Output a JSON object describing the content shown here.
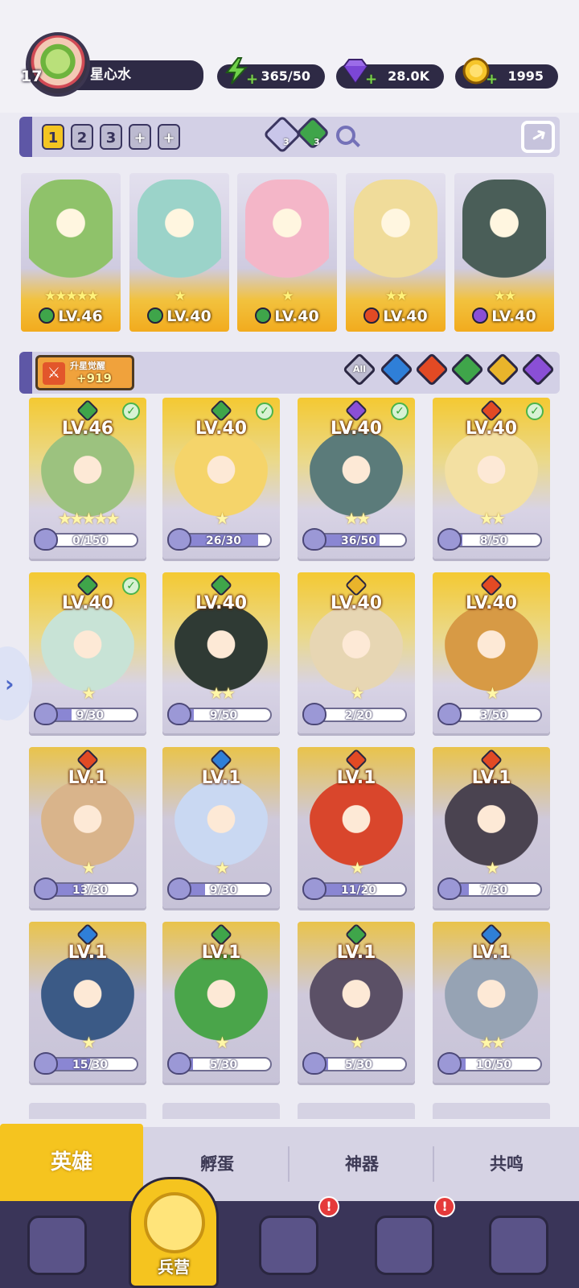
{
  "player": {
    "level": "17",
    "name": "星心水"
  },
  "resources": {
    "energy": "365/50",
    "gems": "28.0K",
    "coins": "1995"
  },
  "team_bar": {
    "tabs": [
      "1",
      "2",
      "3",
      "+",
      "+"
    ],
    "active_tab": "1",
    "gem_purple_count": "3",
    "gem_green_count": "3"
  },
  "team": [
    {
      "level": "LV.46",
      "stars": "★★★★★",
      "element": "nature",
      "art_color": "#8fc26a"
    },
    {
      "level": "LV.40",
      "stars": "★",
      "element": "nature",
      "art_color": "#9bd3c9"
    },
    {
      "level": "LV.40",
      "stars": "★",
      "element": "nature",
      "art_color": "#f4b6c8"
    },
    {
      "level": "LV.40",
      "stars": "★★",
      "element": "fire",
      "art_color": "#f0dc9a"
    },
    {
      "level": "LV.40",
      "stars": "★★",
      "element": "dark",
      "art_color": "#4a5e58"
    }
  ],
  "awaken": {
    "label": "升星觉醒",
    "value": "+919"
  },
  "filters": {
    "all_label": "All",
    "elements": [
      "water",
      "fire",
      "nature",
      "light",
      "dark"
    ]
  },
  "heroes": [
    {
      "level": "LV.46",
      "element": "nature",
      "checked": true,
      "stars": "★★★★★",
      "progress": "0/150",
      "fill": 0.0,
      "art": "#9cc27f"
    },
    {
      "level": "LV.40",
      "element": "nature",
      "checked": true,
      "stars": "★",
      "progress": "26/30",
      "fill": 0.87,
      "art": "#f5d46a"
    },
    {
      "level": "LV.40",
      "element": "dark",
      "checked": true,
      "stars": "★★",
      "progress": "36/50",
      "fill": 0.72,
      "art": "#5b7b7a"
    },
    {
      "level": "LV.40",
      "element": "fire",
      "checked": true,
      "stars": "★★",
      "progress": "8/50",
      "fill": 0.16,
      "art": "#f3e0a2"
    },
    {
      "level": "LV.40",
      "element": "nature",
      "checked": true,
      "stars": "★",
      "progress": "9/30",
      "fill": 0.3,
      "art": "#c8e3d6"
    },
    {
      "level": "LV.40",
      "element": "nature",
      "checked": false,
      "stars": "★★",
      "progress": "9/50",
      "fill": 0.18,
      "art": "#2f3a34"
    },
    {
      "level": "LV.40",
      "element": "light",
      "checked": false,
      "stars": "★",
      "progress": "2/20",
      "fill": 0.1,
      "art": "#e7d6b3"
    },
    {
      "level": "LV.40",
      "element": "fire",
      "checked": false,
      "stars": "★",
      "progress": "3/50",
      "fill": 0.06,
      "art": "#d79a45"
    },
    {
      "level": "LV.1",
      "element": "fire",
      "checked": false,
      "stars": "★",
      "progress": "13/30",
      "fill": 0.43,
      "art": "#d9b48b"
    },
    {
      "level": "LV.1",
      "element": "water",
      "checked": false,
      "stars": "★",
      "progress": "9/30",
      "fill": 0.3,
      "art": "#c9d8f2"
    },
    {
      "level": "LV.1",
      "element": "fire",
      "checked": false,
      "stars": "★",
      "progress": "11/20",
      "fill": 0.55,
      "art": "#d9462c"
    },
    {
      "level": "LV.1",
      "element": "fire",
      "checked": false,
      "stars": "★",
      "progress": "7/30",
      "fill": 0.23,
      "art": "#4a4350"
    },
    {
      "level": "LV.1",
      "element": "water",
      "checked": false,
      "stars": "★",
      "progress": "15/30",
      "fill": 0.5,
      "art": "#3b5a86"
    },
    {
      "level": "LV.1",
      "element": "nature",
      "checked": false,
      "stars": "★",
      "progress": "5/30",
      "fill": 0.17,
      "art": "#4aa54a"
    },
    {
      "level": "LV.1",
      "element": "nature",
      "checked": false,
      "stars": "★",
      "progress": "5/30",
      "fill": 0.17,
      "art": "#5b5066"
    },
    {
      "level": "LV.1",
      "element": "water",
      "checked": false,
      "stars": "★★",
      "progress": "10/50",
      "fill": 0.2,
      "art": "#96a3b4"
    }
  ],
  "subtabs": [
    "英雄",
    "孵蛋",
    "神器",
    "共鸣"
  ],
  "nav": {
    "active_label": "兵营",
    "items": [
      "cards-icon",
      "barracks-icon",
      "map-book-icon",
      "temple-icon",
      "mushroom-icon"
    ],
    "badge_text": "!"
  },
  "colors": {
    "nature": "#3fa54a",
    "fire": "#e24a24",
    "water": "#2f7fd8",
    "light": "#e9b42b",
    "dark": "#8a4fd6",
    "accent": "#f5c41f"
  }
}
